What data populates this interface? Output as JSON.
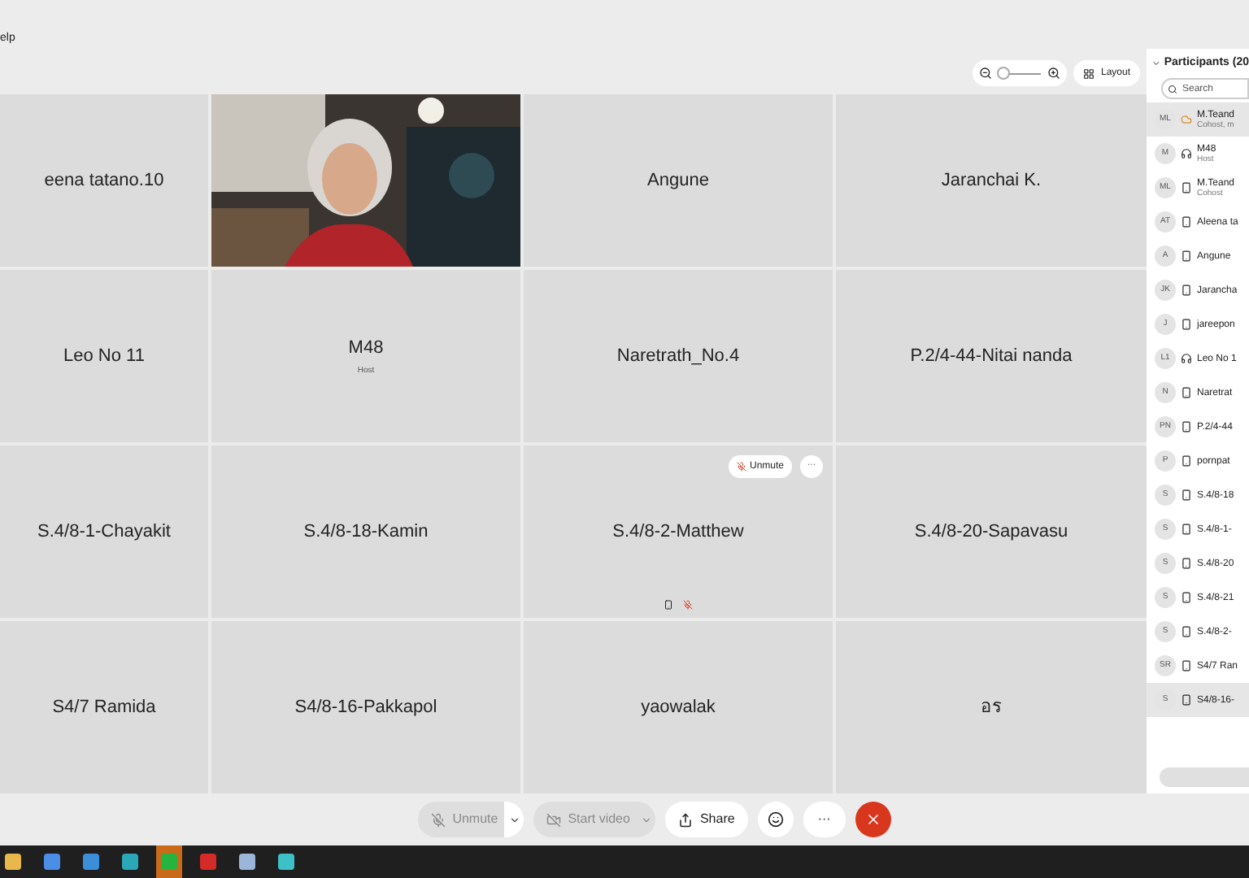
{
  "menu": {
    "label": "elp"
  },
  "view_controls": {
    "zoom": {
      "level": 0.1
    },
    "layout_button": "Layout"
  },
  "tiles": [
    {
      "kind": "name",
      "name": "eena tatano.10"
    },
    {
      "kind": "video"
    },
    {
      "kind": "name",
      "name": "Angune"
    },
    {
      "kind": "name",
      "name": "Jaranchai K."
    },
    {
      "kind": "name",
      "name": "Leo No 11"
    },
    {
      "kind": "name",
      "name": "M48",
      "subtitle": "Host"
    },
    {
      "kind": "name",
      "name": "Naretrath_No.4"
    },
    {
      "kind": "name",
      "name": "P.2/4-44-Nitai nanda"
    },
    {
      "kind": "name",
      "name": "S.4/8-1-Chayakit"
    },
    {
      "kind": "name",
      "name": "S.4/8-18-Kamin"
    },
    {
      "kind": "name",
      "name": "S.4/8-2-Matthew",
      "unmute_button": "Unmute",
      "more_button": "···",
      "muted": true
    },
    {
      "kind": "name",
      "name": "S.4/8-20-Sapavasu"
    },
    {
      "kind": "name",
      "name": "S4/7 Ramida"
    },
    {
      "kind": "name",
      "name": "S4/8-16-Pakkapol"
    },
    {
      "kind": "name",
      "name": "yaowalak"
    },
    {
      "kind": "name",
      "name": "อร"
    }
  ],
  "participants_panel": {
    "title": "Participants (20",
    "search": {
      "placeholder": "Search"
    },
    "participants": [
      {
        "initials": "ML",
        "name": "M.Teand",
        "role": "Cohost, m",
        "kind": "presenter",
        "selected": true
      },
      {
        "initials": "M",
        "name": "M48",
        "role": "Host",
        "kind": "headset",
        "selected": false
      },
      {
        "initials": "ML",
        "name": "M.Teand",
        "role": "Cohost",
        "kind": "phone",
        "selected": false
      },
      {
        "initials": "AT",
        "name": "Aleena ta",
        "kind": "phone",
        "selected": false
      },
      {
        "initials": "A",
        "name": "Angune",
        "kind": "phone",
        "selected": false
      },
      {
        "initials": "JK",
        "name": "Jarancha",
        "kind": "phone",
        "selected": false
      },
      {
        "initials": "J",
        "name": "jareepon",
        "kind": "phone",
        "selected": false
      },
      {
        "initials": "L1",
        "name": "Leo No 1",
        "kind": "headset",
        "selected": false
      },
      {
        "initials": "N",
        "name": "Naretrat",
        "kind": "phone",
        "selected": false
      },
      {
        "initials": "PN",
        "name": "P.2/4-44",
        "kind": "phone",
        "selected": false
      },
      {
        "initials": "P",
        "name": "pornpat",
        "kind": "phone",
        "selected": false
      },
      {
        "initials": "S",
        "name": "S.4/8-18",
        "kind": "phone",
        "selected": false
      },
      {
        "initials": "S",
        "name": "S.4/8-1-",
        "kind": "phone",
        "selected": false
      },
      {
        "initials": "S",
        "name": "S.4/8-20",
        "kind": "phone",
        "selected": false
      },
      {
        "initials": "S",
        "name": "S.4/8-21",
        "kind": "phone",
        "selected": false
      },
      {
        "initials": "S",
        "name": "S.4/8-2-",
        "kind": "phone",
        "selected": false
      },
      {
        "initials": "SR",
        "name": "S4/7 Ran",
        "kind": "phone",
        "selected": false
      },
      {
        "initials": "S",
        "name": "S4/8-16-",
        "kind": "phone",
        "selected": true
      }
    ]
  },
  "toolbar": [
    {
      "kind": "unmute",
      "label": "Unmute",
      "disabled": true
    },
    {
      "kind": "video",
      "label": "Start video",
      "disabled": true
    },
    {
      "kind": "share",
      "label": "Share",
      "disabled": false
    },
    {
      "kind": "reactions",
      "disabled": false
    },
    {
      "kind": "more",
      "label": "···",
      "disabled": false
    },
    {
      "kind": "leave",
      "disabled": false
    }
  ],
  "taskbar": [
    {
      "kind": "folder",
      "active": false
    },
    {
      "kind": "chrome",
      "active": false
    },
    {
      "kind": "mail",
      "active": false
    },
    {
      "kind": "edge",
      "active": false
    },
    {
      "kind": "chat",
      "active": true
    },
    {
      "kind": "pdf",
      "active": false
    },
    {
      "kind": "notes",
      "active": false
    },
    {
      "kind": "meet",
      "active": false
    }
  ]
}
